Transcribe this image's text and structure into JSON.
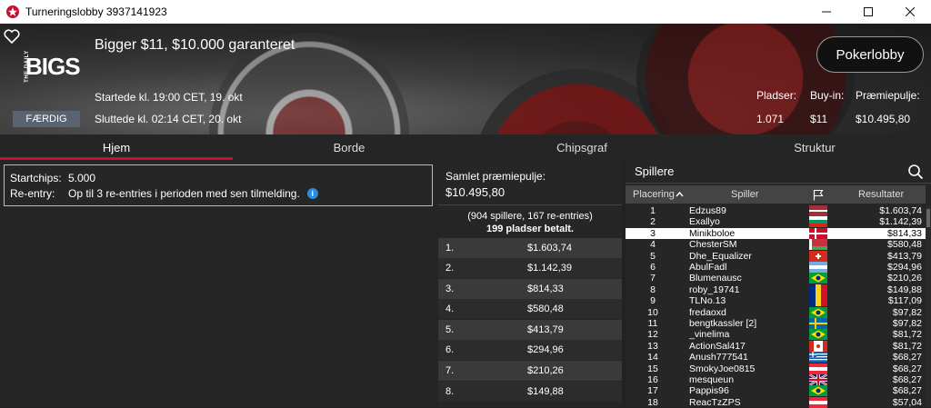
{
  "window": {
    "title": "Turneringslobby 3937141923"
  },
  "header": {
    "tournament_name": "Bigger $11, $10.000 garanteret",
    "logo_small": "THE DAILY",
    "logo_big": "BIGS",
    "status_badge": "FÆRDIG",
    "started": "Startede kl. 19:00 CET, 19. okt",
    "ended": "Sluttede kl. 02:14 CET, 20. okt",
    "lobby_button": "Pokerlobby",
    "stats": {
      "places_label": "Pladser:",
      "buyin_label": "Buy-in:",
      "prizepool_label": "Præmiepulje:",
      "places_value": "1.071",
      "buyin_value": "$11",
      "prizepool_value": "$10.495,80"
    }
  },
  "tabs": [
    {
      "label": "Hjem",
      "active": true
    },
    {
      "label": "Borde",
      "active": false
    },
    {
      "label": "Chipsgraf",
      "active": false
    },
    {
      "label": "Struktur",
      "active": false
    }
  ],
  "info": {
    "startchips_label": "Startchips:",
    "startchips_value": "5.000",
    "reentry_label": "Re-entry:",
    "reentry_value": "Op til 3 re-entries i perioden med sen tilmelding."
  },
  "prizepool": {
    "title": "Samlet præmiepulje:",
    "value": "$10.495,80",
    "entries": "(904 spillere, 167 re-entries)",
    "paid": "199 pladser betalt.",
    "prizes": [
      {
        "rank": "1.",
        "amount": "$1.603,74"
      },
      {
        "rank": "2.",
        "amount": "$1.142,39"
      },
      {
        "rank": "3.",
        "amount": "$814,33"
      },
      {
        "rank": "4.",
        "amount": "$580,48"
      },
      {
        "rank": "5.",
        "amount": "$413,79"
      },
      {
        "rank": "6.",
        "amount": "$294,96"
      },
      {
        "rank": "7.",
        "amount": "$210,26"
      },
      {
        "rank": "8.",
        "amount": "$149,88"
      }
    ]
  },
  "players": {
    "title": "Spillere",
    "columns": {
      "rank": "Placering",
      "player": "Spiller",
      "result": "Resultater"
    },
    "rows": [
      {
        "rank": "1",
        "name": "Edzus89",
        "flag": "latvia",
        "result": "$1.603,74",
        "selected": false
      },
      {
        "rank": "2",
        "name": "Exallyo",
        "flag": "bulgaria",
        "result": "$1.142,39",
        "selected": false
      },
      {
        "rank": "3",
        "name": "Minikboloe",
        "flag": "denmark",
        "result": "$814,33",
        "selected": true
      },
      {
        "rank": "4",
        "name": "ChesterSM",
        "flag": "belarus",
        "result": "$580,48",
        "selected": false
      },
      {
        "rank": "5",
        "name": "Dhe_Equalizer",
        "flag": "switzerland",
        "result": "$413,79",
        "selected": false
      },
      {
        "rank": "6",
        "name": "AbulFadl",
        "flag": "argentina",
        "result": "$294,96",
        "selected": false
      },
      {
        "rank": "7",
        "name": "Blumenausc",
        "flag": "brazil",
        "result": "$210,26",
        "selected": false
      },
      {
        "rank": "8",
        "name": "roby_19741",
        "flag": "romania",
        "result": "$149,88",
        "selected": false
      },
      {
        "rank": "9",
        "name": "TLNo.13",
        "flag": "romania",
        "result": "$117,09",
        "selected": false
      },
      {
        "rank": "10",
        "name": "fredaoxd",
        "flag": "brazil",
        "result": "$97,82",
        "selected": false
      },
      {
        "rank": "11",
        "name": "bengtkassler [2]",
        "flag": "sweden",
        "result": "$97,82",
        "selected": false
      },
      {
        "rank": "12",
        "name": "_vinelima",
        "flag": "brazil",
        "result": "$81,72",
        "selected": false
      },
      {
        "rank": "13",
        "name": "ActionSal417",
        "flag": "canada",
        "result": "$81,72",
        "selected": false
      },
      {
        "rank": "14",
        "name": "Anush777541",
        "flag": "greece",
        "result": "$68,27",
        "selected": false
      },
      {
        "rank": "15",
        "name": "SmokyJoe0815",
        "flag": "austria",
        "result": "$68,27",
        "selected": false
      },
      {
        "rank": "16",
        "name": "mesqueun",
        "flag": "uk",
        "result": "$68,27",
        "selected": false
      },
      {
        "rank": "17",
        "name": "Pappis96",
        "flag": "brazil",
        "result": "$68,27",
        "selected": false
      },
      {
        "rank": "18",
        "name": "ReacTzZPS",
        "flag": "austria",
        "result": "$57,04",
        "selected": false
      }
    ]
  },
  "colors": {
    "accent": "#c8102e",
    "badge": "#5a6470",
    "info": "#2a8de0"
  }
}
